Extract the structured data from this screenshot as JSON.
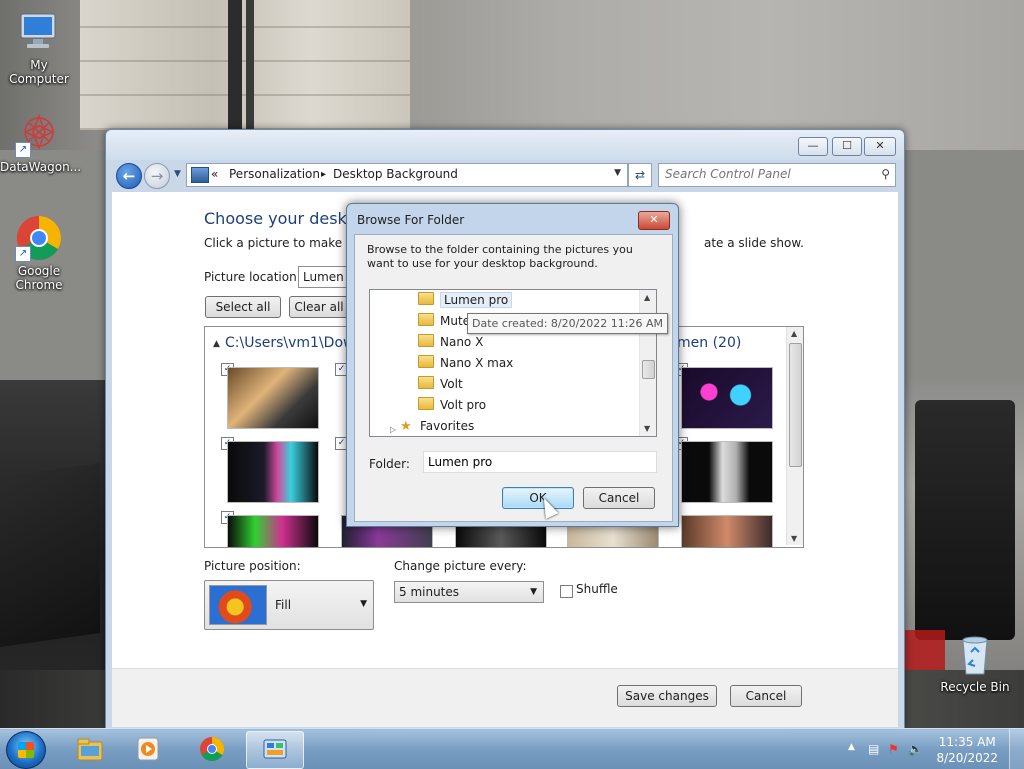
{
  "desktop": {
    "icons": [
      {
        "label": "My Computer"
      },
      {
        "label": "DataWagon..."
      },
      {
        "label": "Google Chrome"
      },
      {
        "label": "Recycle Bin"
      }
    ]
  },
  "control_panel": {
    "address": {
      "overflow": "«",
      "crumb1": "Personalization",
      "separator": "▸",
      "crumb2": "Desktop Background"
    },
    "search": {
      "placeholder": "Search Control Panel"
    },
    "window_buttons": {
      "minimize": "—",
      "maximize": "☐",
      "close": "✕"
    },
    "heading": "Choose your desktop",
    "instruction": "Click a picture to make it y",
    "instruction_tail": "ate a slide show.",
    "picture_location_label": "Picture location:",
    "picture_location_value": "Lumen",
    "select_all": "Select all",
    "clear_all": "Clear all",
    "folder_path": "C:\\Users\\vm1\\Dow",
    "folder_path_right": "men (20)",
    "picture_position_label": "Picture position:",
    "picture_position_value": "Fill",
    "change_every_label": "Change picture every:",
    "change_every_value": "5 minutes",
    "shuffle_label": "Shuffle",
    "save_changes": "Save changes",
    "cancel": "Cancel"
  },
  "browse_dialog": {
    "title": "Browse For Folder",
    "close": "✕",
    "instructions": "Browse to the folder containing the pictures you want to use for your desktop background.",
    "tree": [
      {
        "label": "Lumen pro",
        "selected": true
      },
      {
        "label": "Mute"
      },
      {
        "label": "Nano X"
      },
      {
        "label": "Nano X max"
      },
      {
        "label": "Volt"
      },
      {
        "label": "Volt pro"
      },
      {
        "label": "Favorites"
      }
    ],
    "tooltip": "Date created: 8/20/2022 11:26 AM",
    "folder_label": "Folder:",
    "folder_value": "Lumen pro",
    "ok": "OK",
    "cancel": "Cancel"
  },
  "taskbar": {
    "time": "11:35 AM",
    "date": "8/20/2022"
  }
}
